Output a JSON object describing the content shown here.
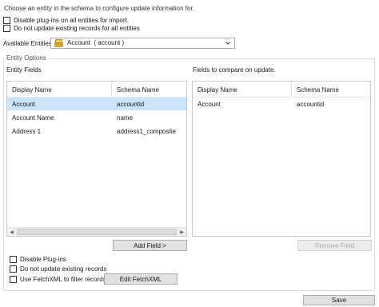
{
  "instructions": "Choose an entity in the schema to configure update information for.",
  "global_options": [
    {
      "label": "Disable plug-ins on all entities for import.",
      "checked": false
    },
    {
      "label": "Do not update existing records for all entities",
      "checked": false
    }
  ],
  "available_entities": {
    "label": "Available Entities",
    "selected": "Account  ( account )",
    "icon": "entity-icon"
  },
  "entity_options": {
    "group_label": "Entity Options",
    "entity_fields": {
      "label": "Entity Fields",
      "columns": [
        "Display Name",
        "Schema Name"
      ],
      "rows": [
        {
          "display": "Account",
          "schema": "accountid",
          "selected": true
        },
        {
          "display": "Account Name",
          "schema": "name",
          "selected": false
        },
        {
          "display": "Address 1",
          "schema": "address1_composite",
          "selected": false
        }
      ]
    },
    "compare_fields": {
      "label": "Fields to compare on update.",
      "columns": [
        "Display Name",
        "Schema Name"
      ],
      "rows": [
        {
          "display": "Account",
          "schema": "accountid"
        }
      ]
    },
    "add_field_label": "Add Field >",
    "remove_field_label": "Remove Field",
    "options": [
      {
        "label": "Disable Plug-ins",
        "checked": false
      },
      {
        "label": "Do not update existing records",
        "checked": false
      },
      {
        "label": "Use FetchXML to filter records",
        "checked": false
      }
    ],
    "edit_fetchxml_label": "Edit FetchXML"
  },
  "save_label": "Save",
  "colors": {
    "selection": "#cce4f7",
    "button": "#e1e1e1"
  }
}
